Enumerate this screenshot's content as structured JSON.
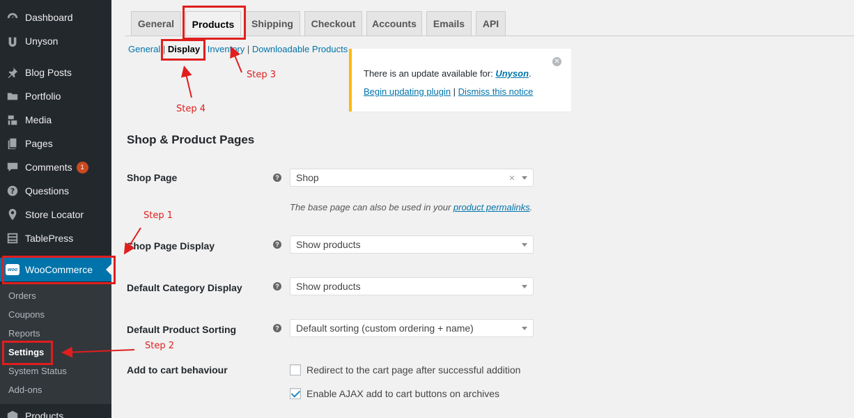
{
  "sidebar": {
    "items": [
      {
        "label": "Dashboard",
        "icon": "dashboard-icon"
      },
      {
        "label": "Unyson",
        "icon": "unyson-icon"
      },
      {
        "label": "Blog Posts",
        "icon": "pin-icon"
      },
      {
        "label": "Portfolio",
        "icon": "folder-icon"
      },
      {
        "label": "Media",
        "icon": "media-icon"
      },
      {
        "label": "Pages",
        "icon": "pages-icon"
      },
      {
        "label": "Comments",
        "icon": "comments-icon",
        "badge": "1"
      },
      {
        "label": "Questions",
        "icon": "question-icon"
      },
      {
        "label": "Store Locator",
        "icon": "location-icon"
      },
      {
        "label": "TablePress",
        "icon": "table-icon"
      },
      {
        "label": "WooCommerce",
        "icon": "woo-icon",
        "logo_text": "woo"
      },
      {
        "label": "Products",
        "icon": "products-icon"
      }
    ],
    "submenu": [
      {
        "label": "Orders"
      },
      {
        "label": "Coupons"
      },
      {
        "label": "Reports"
      },
      {
        "label": "Settings"
      },
      {
        "label": "System Status"
      },
      {
        "label": "Add-ons"
      }
    ]
  },
  "tabs": [
    "General",
    "Products",
    "Shipping",
    "Checkout",
    "Accounts",
    "Emails",
    "API"
  ],
  "subsections": {
    "general": "General",
    "display": "Display",
    "inventory": "Inventory",
    "downloadable": "Downloadable Products",
    "sep": "|"
  },
  "notice": {
    "text": "There is an update available for: ",
    "plugin": "Unyson",
    "period": ".",
    "begin_link": "Begin updating plugin",
    "sep": " | ",
    "dismiss_link": "Dismiss this notice"
  },
  "section_title": "Shop & Product Pages",
  "fields": {
    "shop_page": {
      "label": "Shop Page",
      "value": "Shop"
    },
    "shop_page_desc": {
      "prefix": "The base page can also be used in your ",
      "link": "product permalinks",
      "suffix": "."
    },
    "shop_page_display": {
      "label": "Shop Page Display",
      "value": "Show products"
    },
    "default_category_display": {
      "label": "Default Category Display",
      "value": "Show products"
    },
    "default_product_sorting": {
      "label": "Default Product Sorting",
      "value": "Default sorting (custom ordering + name)"
    },
    "add_to_cart": {
      "label": "Add to cart behaviour",
      "options": [
        {
          "label": "Redirect to the cart page after successful addition",
          "checked": false
        },
        {
          "label": "Enable AJAX add to cart buttons on archives",
          "checked": true
        }
      ]
    }
  },
  "annotations": {
    "step1": "Step 1",
    "step2": "Step 2",
    "step3": "Step 3",
    "step4": "Step 4",
    "color": "#e01e1e"
  },
  "colors": {
    "sidebar_bg": "#23282d",
    "active_menu": "#0073aa",
    "link": "#0073aa",
    "notice_border": "#ffb900"
  }
}
